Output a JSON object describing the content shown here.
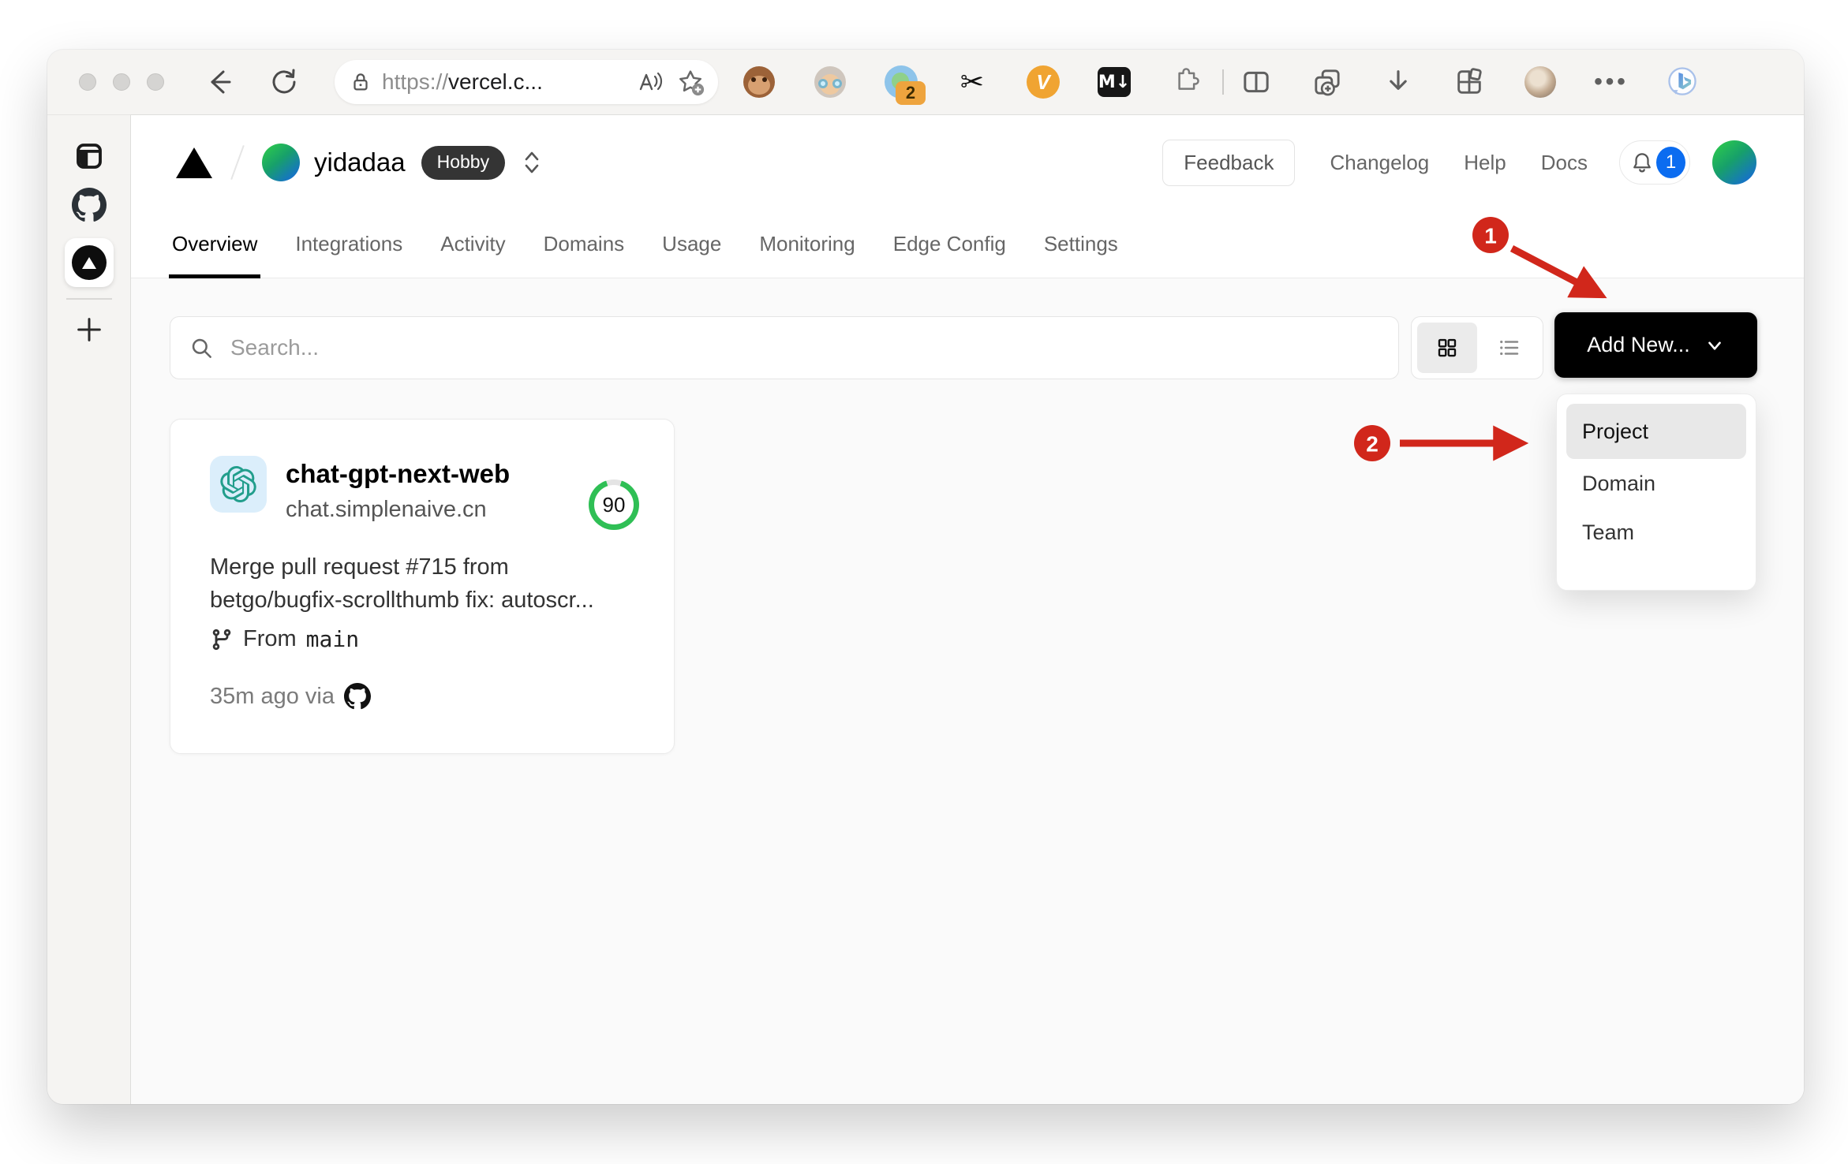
{
  "browser": {
    "address": {
      "scheme": "https://",
      "host": "vercel.c..."
    },
    "extensions": {
      "proxy_badge": "2",
      "v_label": "V",
      "markdown_label": "M↓",
      "scissors_glyph": "✂"
    },
    "more_glyph": "•••"
  },
  "vercel": {
    "header": {
      "team_name": "yidadaa",
      "plan_badge": "Hobby",
      "feedback": "Feedback",
      "changelog": "Changelog",
      "help": "Help",
      "docs": "Docs",
      "notification_count": "1"
    },
    "tabs": [
      {
        "label": "Overview",
        "active": true
      },
      {
        "label": "Integrations",
        "active": false
      },
      {
        "label": "Activity",
        "active": false
      },
      {
        "label": "Domains",
        "active": false
      },
      {
        "label": "Usage",
        "active": false
      },
      {
        "label": "Monitoring",
        "active": false
      },
      {
        "label": "Edge Config",
        "active": false
      },
      {
        "label": "Settings",
        "active": false
      }
    ],
    "toolbar": {
      "search_placeholder": "Search...",
      "add_new": "Add New..."
    },
    "card": {
      "name": "chat-gpt-next-web",
      "domain": "chat.simplenaive.cn",
      "score": "90",
      "commit_line1": "Merge pull request #715 from",
      "commit_line2": "betgo/bugfix-scrollthumb fix: autoscr...",
      "branch_prefix": "From",
      "branch": "main",
      "deployed": "35m ago via"
    },
    "menu": {
      "items": [
        "Project",
        "Domain",
        "Team"
      ]
    }
  },
  "annotations": {
    "step1": "1",
    "step2": "2"
  },
  "colors": {
    "annotation_red": "#d1271b",
    "score_green": "#2fbf55",
    "notification_blue": "#0b6cf0",
    "hobby_badge_bg": "#343434",
    "add_new_bg": "#000000",
    "page_bg": "#fafafa",
    "chrome_bg": "#f5f4f2",
    "openai_teal": "#229e8c"
  }
}
